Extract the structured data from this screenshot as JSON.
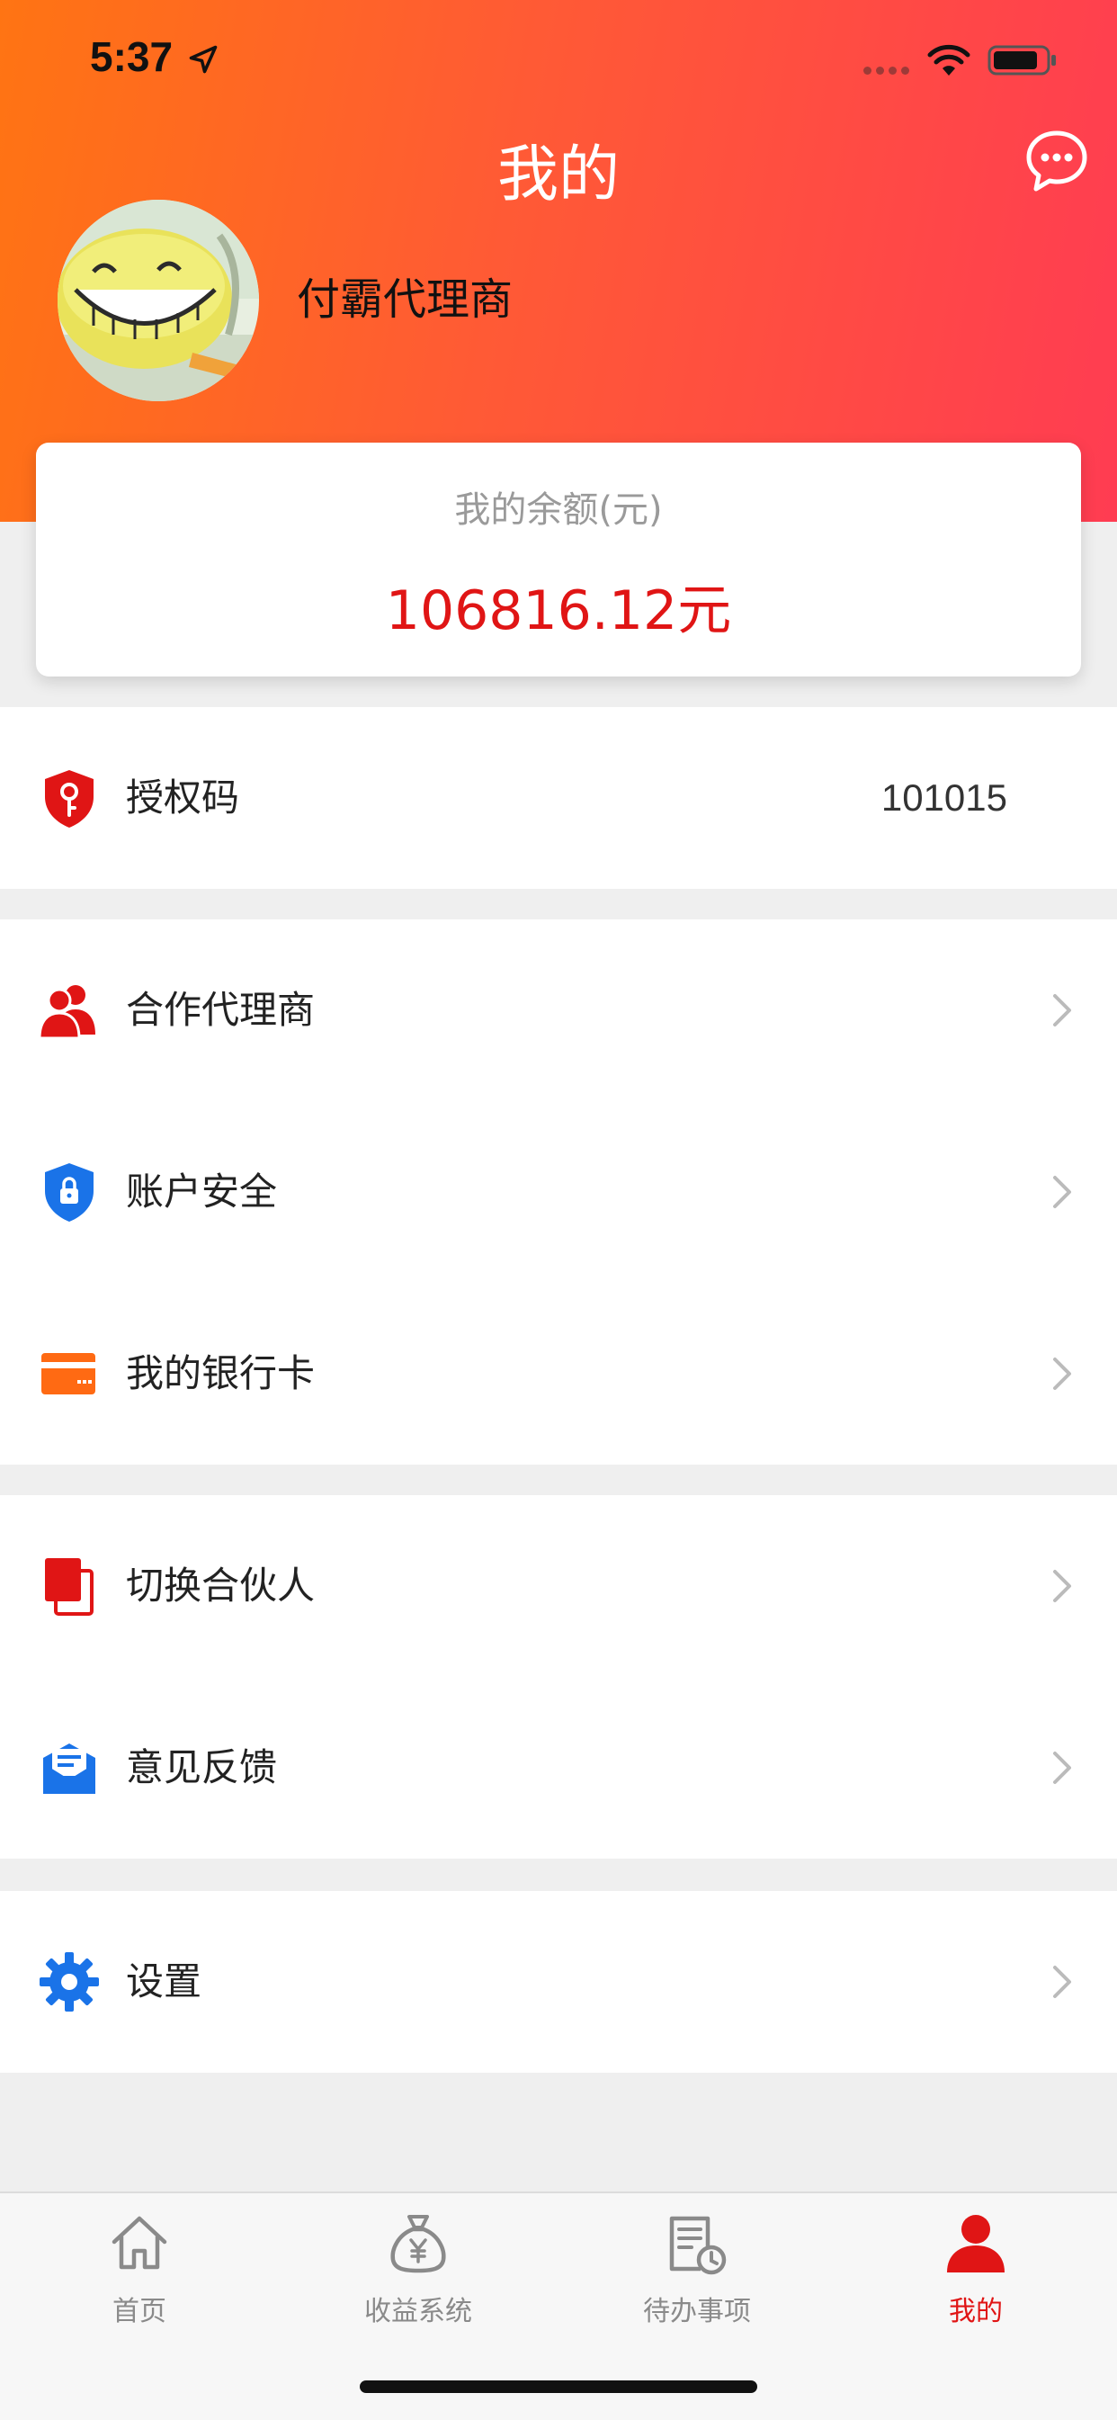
{
  "status_bar": {
    "time": "5:37"
  },
  "header": {
    "title": "我的",
    "user_name": "付霸代理商"
  },
  "balance": {
    "label": "我的余额(元)",
    "value": "106816.12元"
  },
  "menu": {
    "auth_code": {
      "label": "授权码",
      "value": "101015",
      "icon": "shield-key-icon"
    },
    "partners": {
      "label": "合作代理商",
      "icon": "people-icon"
    },
    "account_security": {
      "label": "账户安全",
      "icon": "lock-shield-icon"
    },
    "bank_card": {
      "label": "我的银行卡",
      "icon": "card-icon"
    },
    "switch_partner": {
      "label": "切换合伙人",
      "icon": "switch-icon"
    },
    "feedback": {
      "label": "意见反馈",
      "icon": "feedback-icon"
    },
    "settings": {
      "label": "设置",
      "icon": "gear-icon"
    }
  },
  "tabbar": {
    "home": "首页",
    "earnings": "收益系统",
    "todo": "待办事项",
    "mine": "我的",
    "active_tab": "mine"
  },
  "colors": {
    "header_start": "#ff7413",
    "header_end": "#ff3c52",
    "accent_red": "#e01515",
    "icon_blue": "#1a73e8",
    "icon_orange": "#ff6a13"
  }
}
